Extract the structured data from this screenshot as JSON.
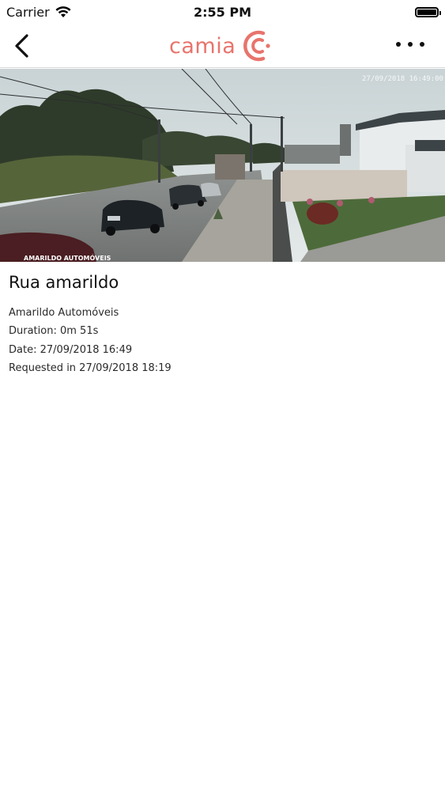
{
  "status_bar": {
    "carrier": "Carrier",
    "time": "2:55 PM"
  },
  "nav": {
    "logo_text": "camia",
    "back_icon": "chevron-left-icon",
    "more_icon": "ellipsis-icon",
    "brand_color": "#e8746c"
  },
  "video": {
    "timestamp_overlay": "27/09/2018 16:49:00",
    "camera_label_overlay": "AMARILDO AUTOMÓVEIS"
  },
  "detail": {
    "title": "Rua amarildo",
    "camera_name": "Amarildo Automóveis",
    "duration": "Duration: 0m 51s",
    "date": "Date: 27/09/2018 16:49",
    "requested": "Requested in 27/09/2018 18:19"
  }
}
